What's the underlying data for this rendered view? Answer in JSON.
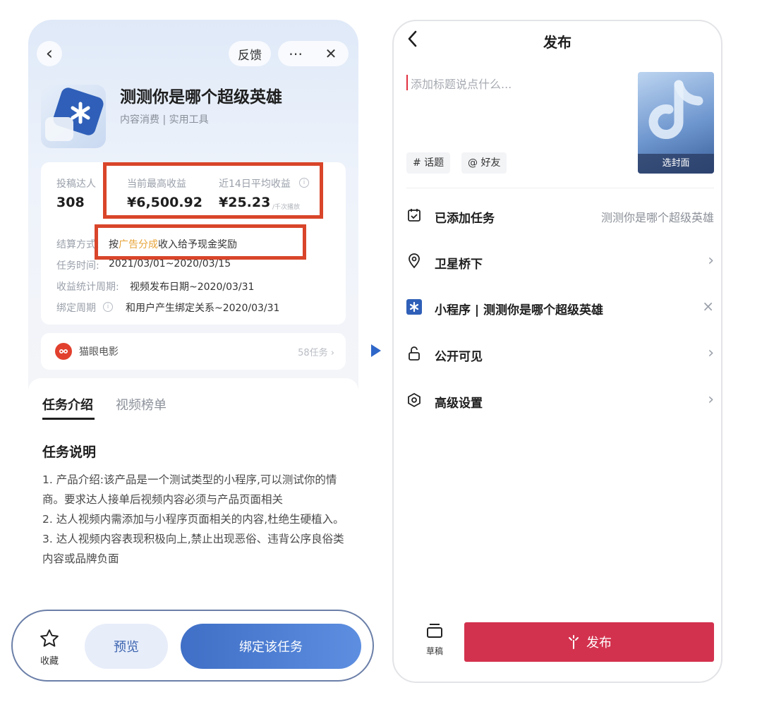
{
  "left": {
    "header": {
      "feedback_label": "反馈",
      "more_icon": "⋯",
      "close_icon": "✕",
      "back_icon": "‹"
    },
    "app": {
      "title": "测测你是哪个超级英雄",
      "subtitle": "内容消费 | 实用工具"
    },
    "stats": {
      "creators_label": "投稿达人",
      "creators_value": "308",
      "max_income_label": "当前最高收益",
      "max_income_value": "¥6,500.92",
      "avg_income_label": "近14日平均收益",
      "avg_income_value": "¥25.23",
      "avg_income_unit": "/千次播放"
    },
    "details": {
      "settle_label": "结算方式:",
      "settle_prefix": "按",
      "settle_highlight": "广告分成",
      "settle_suffix": "收入给予现金奖励",
      "time_label": "任务时间:",
      "time_value": "2021/03/01~2020/03/15",
      "stat_period_label": "收益统计周期:",
      "stat_period_value": "视频发布日期~2020/03/31",
      "bind_period_label": "绑定周期",
      "bind_period_value": "和用户产生绑定关系~2020/03/31"
    },
    "brand": {
      "name": "猫眼电影",
      "count": "58任务 ›"
    },
    "tabs": {
      "active": "任务介绍",
      "inactive": "视频榜单"
    },
    "section_title": "任务说明",
    "description": [
      "1. 产品介绍:该产品是一个测试类型的小程序,可以测试你的情商。要求达人接单后视频内容必须与产品页面相关",
      "2. 达人视频内需添加与小程序页面相关的内容,杜绝生硬植入。",
      "3. 达人视频内容表现积极向上,禁止出现恶俗、违背公序良俗类内容或品牌负面"
    ],
    "bottom": {
      "favorite_label": "收藏",
      "preview_label": "预览",
      "bind_label": "绑定该任务"
    }
  },
  "right": {
    "title": "发布",
    "caption_placeholder": "添加标题说点什么...",
    "cover_label": "选封面",
    "chips": {
      "topic": "# 话题",
      "mention": "@ 好友"
    },
    "menu": {
      "task_label": "已添加任务",
      "task_value": "测测你是哪个超级英雄",
      "location_label": "卫星桥下",
      "mini_program_label": "小程序 | 测测你是哪个超级英雄",
      "visibility_label": "公开可见",
      "advanced_label": "高级设置"
    },
    "draft_label": "草稿",
    "publish_label": "发布"
  },
  "colors": {
    "accent_blue": "#3f6fc6",
    "publish_red": "#d3324e",
    "highlight_orange": "#e7a43a",
    "annotation_red": "#d9452a"
  }
}
